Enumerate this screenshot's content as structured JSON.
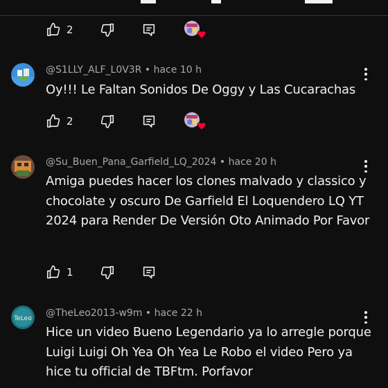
{
  "comments": [
    {
      "likes": "2"
    },
    {
      "author": "@S1LLY_ALF_L0V3R",
      "time": "hace 10 h",
      "text": "Oy!!! Le Faltan Sonidos De Oggy y Las Cucarachas",
      "likes": "2"
    },
    {
      "author": "@Su_Buen_Pana_Garfield_LQ_2024",
      "time": "hace 20 h",
      "text": "Amiga puedes hacer los clones malvado y classico y chocolate y oscuro De Garfield El Loquendero LQ YT 2024 para Render De Versión Oto Animado Por Favor",
      "likes": "1"
    },
    {
      "author": "@TheLeo2013-w9m",
      "time": "hace 22 h",
      "text": "Hice un video Bueno Legendario ya lo arregle porque Luigi Luigi Oh Yea Oh Yea Le Robo el video Pero ya hice tu official de TBFtm. Porfavor"
    }
  ],
  "separator": "•",
  "icons": [
    "like-icon",
    "dislike-icon",
    "reply-icon",
    "creator-heart-icon",
    "more-options-icon"
  ],
  "colors": {
    "background": "#0f0f0f",
    "text": "#f1f1f1",
    "meta": "#aaaaaa",
    "heart": "#ff0033"
  }
}
